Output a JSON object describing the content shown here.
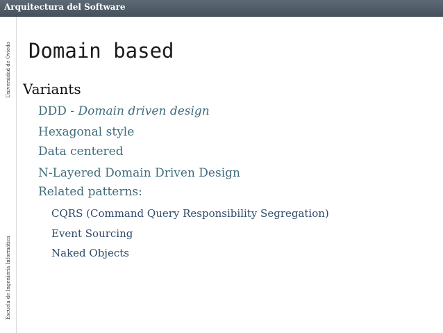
{
  "header": {
    "title": "Arquitectura del Software"
  },
  "sidebar": {
    "top_text": "Universidad de Oviedo",
    "bottom_text": "Escuela de Ingeniería Informática"
  },
  "slide": {
    "title": "Domain based",
    "heading": "Variants",
    "items": [
      {
        "prefix": "DDD - ",
        "emphasis": "Domain driven design"
      },
      {
        "text": "Hexagonal style"
      },
      {
        "text": "Data centered"
      },
      {
        "text": "N-Layered Domain Driven Design"
      },
      {
        "text": "Related patterns:"
      }
    ],
    "subitems": [
      "CQRS (Command Query Responsibility Segregation)",
      "Event Sourcing",
      "Naked Objects"
    ]
  }
}
